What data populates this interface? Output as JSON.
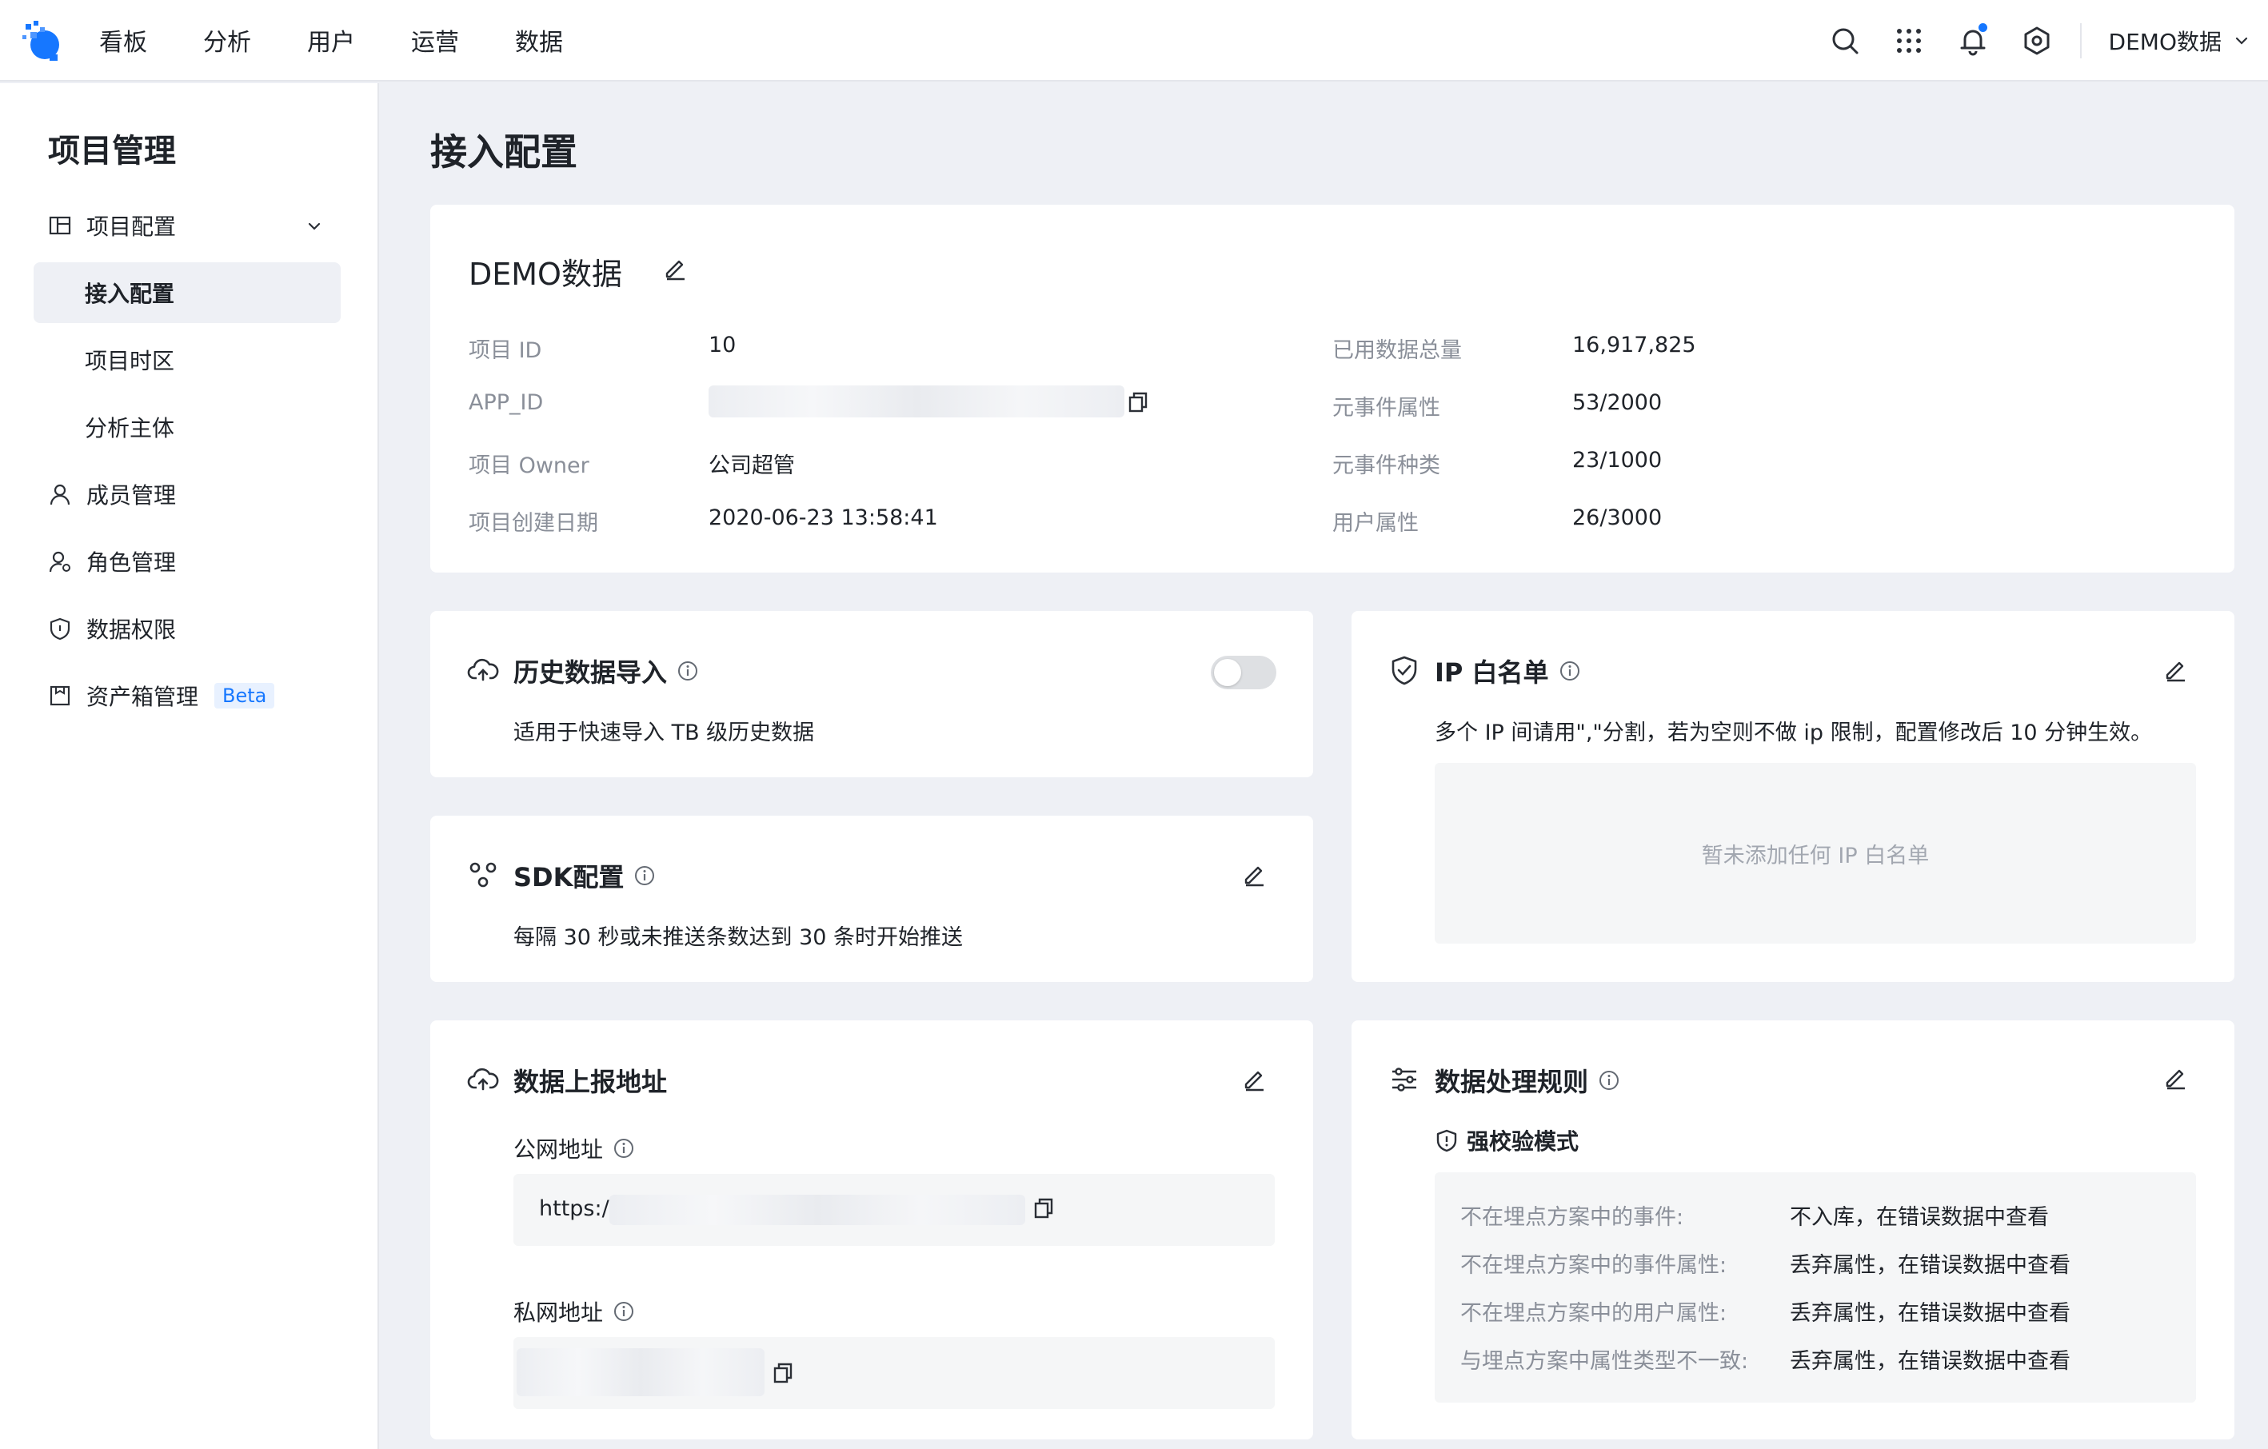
{
  "nav": {
    "items": [
      "看板",
      "分析",
      "用户",
      "运营",
      "数据"
    ],
    "project": "DEMO数据"
  },
  "colors": {
    "accent": "#1677ff",
    "page_bg": "#eef0f5"
  },
  "sidebar": {
    "title": "项目管理",
    "items": [
      {
        "label": "项目配置",
        "icon": "layout-icon"
      },
      {
        "label": "接入配置"
      },
      {
        "label": "项目时区"
      },
      {
        "label": "分析主体"
      },
      {
        "label": "成员管理",
        "icon": "user-icon"
      },
      {
        "label": "角色管理",
        "icon": "role-icon"
      },
      {
        "label": "数据权限",
        "icon": "shield-icon"
      },
      {
        "label": "资产箱管理",
        "icon": "box-icon",
        "badge": "Beta"
      }
    ]
  },
  "page": {
    "title": "接入配置"
  },
  "project": {
    "name": "DEMO数据",
    "left": [
      {
        "label": "项目 ID",
        "value": "10"
      },
      {
        "label": "APP_ID",
        "value": ""
      },
      {
        "label": "项目 Owner",
        "value": "公司超管"
      },
      {
        "label": "项目创建日期",
        "value": "2020-06-23 13:58:41"
      }
    ],
    "right": [
      {
        "label": "已用数据总量",
        "value": "16,917,825"
      },
      {
        "label": "元事件属性",
        "value": "53/2000"
      },
      {
        "label": "元事件种类",
        "value": "23/1000"
      },
      {
        "label": "用户属性",
        "value": "26/3000"
      }
    ]
  },
  "history": {
    "title": "历史数据导入",
    "desc": "适用于快速导入 TB 级历史数据",
    "enabled": false
  },
  "sdk": {
    "title": "SDK配置",
    "desc": "每隔 30 秒或未推送条数达到 30 条时开始推送"
  },
  "report": {
    "title": "数据上报地址",
    "public_label": "公网地址",
    "public_value": "https:/",
    "private_label": "私网地址"
  },
  "ip": {
    "title": "IP 白名单",
    "desc": "多个 IP 间请用\",\"分割，若为空则不做 ip 限制，配置修改后 10 分钟生效。",
    "empty": "暂未添加任何 IP 白名单"
  },
  "rules": {
    "title": "数据处理规则",
    "mode": "强校验模式",
    "rows": [
      {
        "label": "不在埋点方案中的事件:",
        "value": "不入库，在错误数据中查看"
      },
      {
        "label": "不在埋点方案中的事件属性:",
        "value": "丢弃属性，在错误数据中查看"
      },
      {
        "label": "不在埋点方案中的用户属性:",
        "value": "丢弃属性，在错误数据中查看"
      },
      {
        "label": "与埋点方案中属性类型不一致:",
        "value": "丢弃属性，在错误数据中查看"
      }
    ]
  }
}
